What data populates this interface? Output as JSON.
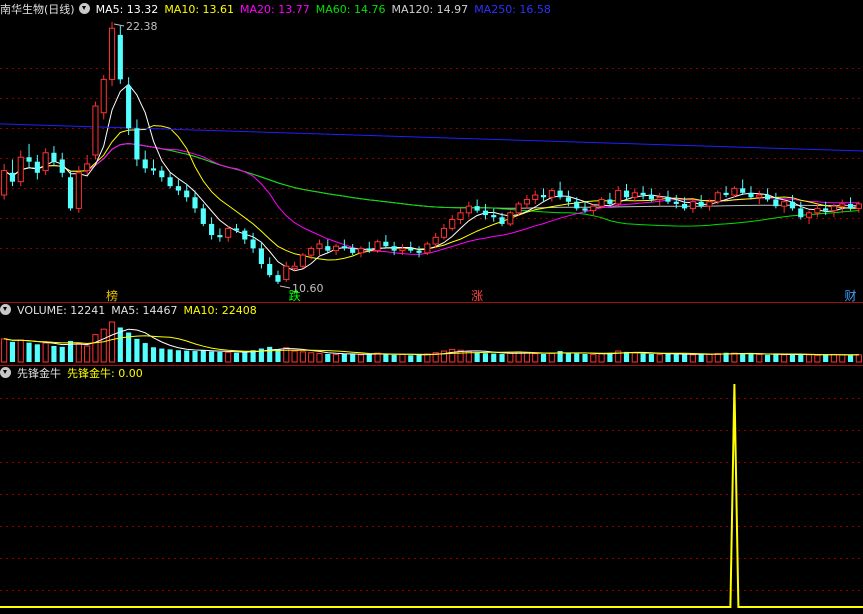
{
  "title": "南华生物(日线)",
  "ma_legend": {
    "ma5": "MA5: 13.32",
    "ma10": "MA10: 13.61",
    "ma20": "MA20: 13.77",
    "ma60": "MA60: 14.76",
    "ma120": "MA120: 14.97",
    "ma250": "MA250: 16.58"
  },
  "vol_legend": {
    "vol": "VOLUME: 12241",
    "ma5": "MA5: 14467",
    "ma10": "MA10: 22408"
  },
  "ind_legend": {
    "name": "先锋金牛",
    "value": "先锋金牛: 0.00"
  },
  "colors": {
    "up": "#ff3232",
    "down": "#54ffff",
    "ma5": "#ffffff",
    "ma10": "#ffff00",
    "ma20": "#ff00ff",
    "ma60": "#00e000",
    "ma120": "#c0c0c0",
    "ma250": "#2020ff",
    "grid": "#8b0000",
    "indicator": "#ffff00"
  },
  "chart_data": [
    {
      "type": "candlestick",
      "price_high_label": "22.38",
      "price_low_label": "10.60",
      "annotations": [
        {
          "label": "榜",
          "index": 13,
          "color": "#e6c000"
        },
        {
          "label": "跌",
          "index": 35,
          "color": "#00ff00"
        },
        {
          "label": "涨",
          "index": 57,
          "color": "#ff4040"
        },
        {
          "label": "财",
          "index": 102,
          "color": "#40a0ff"
        }
      ],
      "ohlc": [
        [
          14.6,
          16.0,
          14.4,
          15.7
        ],
        [
          15.6,
          16.2,
          15.0,
          15.2
        ],
        [
          15.2,
          16.6,
          15.0,
          16.3
        ],
        [
          16.3,
          16.9,
          15.8,
          16.1
        ],
        [
          16.1,
          16.4,
          15.3,
          15.6
        ],
        [
          15.7,
          16.7,
          15.5,
          16.5
        ],
        [
          16.5,
          16.8,
          15.9,
          16.1
        ],
        [
          16.2,
          16.5,
          15.4,
          15.6
        ],
        [
          15.4,
          15.7,
          13.9,
          14.0
        ],
        [
          14.0,
          15.9,
          13.8,
          15.6
        ],
        [
          15.7,
          16.4,
          15.5,
          16.0
        ],
        [
          16.4,
          18.8,
          16.2,
          18.6
        ],
        [
          18.3,
          20.0,
          18.0,
          19.8
        ],
        [
          19.8,
          22.38,
          19.5,
          22.1
        ],
        [
          21.8,
          22.2,
          19.6,
          19.8
        ],
        [
          19.5,
          19.9,
          17.3,
          17.6
        ],
        [
          17.6,
          18.0,
          15.9,
          16.2
        ],
        [
          16.2,
          16.6,
          15.6,
          15.8
        ],
        [
          15.8,
          16.2,
          15.5,
          15.7
        ],
        [
          15.7,
          15.9,
          15.2,
          15.4
        ],
        [
          15.4,
          15.6,
          14.9,
          15.0
        ],
        [
          15.0,
          15.3,
          14.6,
          14.8
        ],
        [
          14.8,
          15.1,
          14.3,
          14.5
        ],
        [
          14.5,
          14.8,
          13.8,
          14.0
        ],
        [
          14.0,
          14.2,
          13.2,
          13.3
        ],
        [
          13.3,
          13.6,
          12.6,
          12.8
        ],
        [
          12.8,
          13.1,
          12.5,
          12.7
        ],
        [
          12.7,
          13.2,
          12.5,
          13.1
        ],
        [
          13.1,
          13.3,
          12.9,
          13.0
        ],
        [
          13.0,
          13.1,
          12.4,
          12.6
        ],
        [
          12.6,
          12.9,
          12.0,
          12.2
        ],
        [
          12.2,
          12.5,
          11.3,
          11.5
        ],
        [
          11.5,
          11.8,
          10.9,
          11.0
        ],
        [
          11.0,
          11.2,
          10.6,
          10.7
        ],
        [
          10.8,
          11.6,
          10.7,
          11.4
        ],
        [
          11.3,
          11.6,
          11.2,
          11.4
        ],
        [
          11.4,
          12.0,
          11.3,
          11.9
        ],
        [
          11.9,
          12.3,
          11.7,
          12.2
        ],
        [
          12.2,
          12.6,
          11.9,
          12.4
        ],
        [
          12.3,
          12.6,
          12.0,
          12.1
        ],
        [
          12.1,
          12.4,
          11.9,
          12.3
        ],
        [
          12.3,
          12.6,
          12.1,
          12.2
        ],
        [
          12.2,
          12.4,
          11.9,
          12.0
        ],
        [
          12.0,
          12.3,
          11.8,
          12.2
        ],
        [
          12.2,
          12.5,
          12.0,
          12.1
        ],
        [
          12.1,
          12.6,
          12.0,
          12.5
        ],
        [
          12.5,
          12.8,
          12.2,
          12.3
        ],
        [
          12.3,
          12.5,
          11.9,
          12.1
        ],
        [
          12.1,
          12.4,
          11.9,
          12.2
        ],
        [
          12.2,
          12.5,
          12.0,
          12.1
        ],
        [
          12.1,
          12.3,
          11.8,
          12.0
        ],
        [
          12.0,
          12.5,
          11.9,
          12.4
        ],
        [
          12.4,
          12.9,
          12.2,
          12.7
        ],
        [
          12.7,
          13.3,
          12.6,
          13.1
        ],
        [
          13.1,
          13.7,
          13.0,
          13.5
        ],
        [
          13.5,
          14.0,
          13.3,
          13.8
        ],
        [
          13.8,
          14.3,
          13.6,
          14.1
        ],
        [
          14.1,
          14.4,
          13.8,
          13.9
        ],
        [
          13.9,
          14.2,
          13.5,
          13.7
        ],
        [
          13.7,
          14.0,
          13.4,
          13.6
        ],
        [
          13.6,
          13.8,
          13.2,
          13.3
        ],
        [
          13.3,
          13.9,
          13.2,
          13.8
        ],
        [
          13.8,
          14.3,
          13.7,
          14.2
        ],
        [
          14.2,
          14.6,
          14.0,
          14.4
        ],
        [
          14.4,
          14.8,
          14.2,
          14.6
        ],
        [
          14.6,
          14.9,
          14.3,
          14.5
        ],
        [
          14.5,
          14.9,
          14.3,
          14.8
        ],
        [
          14.8,
          15.2,
          14.4,
          14.5
        ],
        [
          14.5,
          14.8,
          14.1,
          14.3
        ],
        [
          14.3,
          14.5,
          13.9,
          14.0
        ],
        [
          14.0,
          14.3,
          13.8,
          13.9
        ],
        [
          13.9,
          14.2,
          13.7,
          14.1
        ],
        [
          14.1,
          14.5,
          14.0,
          14.4
        ],
        [
          14.4,
          14.7,
          14.1,
          14.2
        ],
        [
          14.2,
          15.0,
          14.1,
          14.8
        ],
        [
          14.8,
          15.1,
          14.4,
          14.5
        ],
        [
          14.5,
          14.9,
          14.3,
          14.7
        ],
        [
          14.7,
          15.0,
          14.4,
          14.6
        ],
        [
          14.6,
          14.9,
          14.3,
          14.4
        ],
        [
          14.4,
          14.7,
          14.1,
          14.5
        ],
        [
          14.5,
          14.8,
          14.2,
          14.3
        ],
        [
          14.3,
          14.6,
          14.0,
          14.2
        ],
        [
          14.2,
          14.5,
          13.9,
          14.0
        ],
        [
          14.0,
          14.4,
          13.8,
          14.3
        ],
        [
          14.3,
          14.6,
          14.0,
          14.1
        ],
        [
          14.1,
          14.4,
          13.9,
          14.3
        ],
        [
          14.3,
          14.8,
          14.2,
          14.7
        ],
        [
          14.7,
          15.0,
          14.5,
          14.6
        ],
        [
          14.6,
          15.0,
          14.5,
          14.9
        ],
        [
          14.9,
          15.3,
          14.6,
          14.7
        ],
        [
          14.7,
          15.0,
          14.4,
          14.5
        ],
        [
          14.5,
          14.8,
          14.2,
          14.6
        ],
        [
          14.6,
          14.9,
          14.3,
          14.4
        ],
        [
          14.4,
          14.7,
          14.0,
          14.1
        ],
        [
          14.1,
          14.4,
          13.8,
          14.3
        ],
        [
          14.3,
          14.6,
          13.9,
          14.0
        ],
        [
          14.0,
          14.3,
          13.5,
          13.6
        ],
        [
          13.6,
          13.9,
          13.3,
          13.8
        ],
        [
          13.8,
          14.2,
          13.6,
          14.0
        ],
        [
          14.0,
          14.3,
          13.7,
          13.9
        ],
        [
          13.9,
          14.2,
          13.6,
          14.1
        ],
        [
          14.1,
          14.4,
          13.8,
          14.2
        ],
        [
          14.2,
          14.5,
          13.9,
          14.0
        ],
        [
          14.0,
          14.3,
          13.8,
          14.2
        ]
      ],
      "ma250_endpoints": [
        17.8,
        16.58
      ]
    },
    {
      "type": "bar",
      "series_name": "VOLUME",
      "values": [
        5.5,
        4.8,
        5.2,
        4.6,
        4.2,
        4.5,
        3.8,
        3.6,
        5.0,
        4.5,
        3.8,
        6.5,
        7.8,
        9.5,
        8.2,
        7.0,
        5.5,
        4.5,
        3.5,
        3.2,
        3.0,
        2.8,
        2.7,
        2.6,
        2.8,
        2.5,
        2.4,
        2.3,
        2.2,
        2.4,
        2.8,
        3.2,
        3.6,
        3.0,
        3.4,
        2.6,
        2.4,
        2.2,
        2.0,
        1.9,
        1.8,
        2.0,
        1.9,
        1.7,
        1.8,
        2.1,
        1.9,
        1.7,
        1.8,
        1.6,
        1.7,
        1.9,
        2.2,
        2.6,
        3.0,
        2.8,
        2.5,
        2.3,
        2.1,
        2.0,
        1.9,
        2.1,
        2.4,
        2.2,
        2.0,
        1.9,
        2.1,
        2.6,
        2.2,
        2.0,
        1.9,
        1.8,
        2.0,
        2.2,
        2.6,
        2.4,
        2.2,
        2.0,
        1.9,
        1.8,
        1.9,
        2.0,
        1.8,
        1.7,
        1.9,
        1.8,
        2.0,
        2.2,
        2.1,
        2.0,
        1.9,
        1.8,
        1.7,
        1.8,
        1.7,
        1.9,
        1.8,
        1.7,
        1.6,
        1.7,
        1.8,
        1.7,
        1.6,
        1.7
      ]
    },
    {
      "type": "line",
      "series_name": "先锋金牛",
      "spike_index": 88,
      "spike_value": 1.0,
      "baseline_value": 0
    }
  ]
}
